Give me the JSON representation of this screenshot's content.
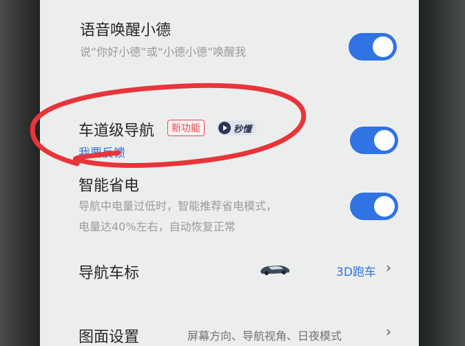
{
  "settings": {
    "voice_wake": {
      "title": "语音唤醒小德",
      "desc": "说“你好小德”或“小德小德”唤醒我",
      "enabled": true
    },
    "lane_nav": {
      "title": "车道级导航",
      "badge_new": "新功能",
      "badge_video": "秒懂",
      "feedback_link": "我要反馈",
      "enabled": true
    },
    "power_save": {
      "title": "智能省电",
      "desc_line1": "导航中电量过低时，智能推荐省电模式，",
      "desc_line2": "电量达40%左右，自动恢复正常",
      "enabled": true
    },
    "nav_icon": {
      "title": "导航车标",
      "value": "3D跑车",
      "icon": "sports-car-icon"
    },
    "display": {
      "title": "图面设置",
      "value": "屏幕方向、导航视角、日夜模式"
    }
  },
  "colors": {
    "accent": "#2f73e4",
    "badge_red": "#e5484d",
    "annotation_red": "#e8343a"
  }
}
